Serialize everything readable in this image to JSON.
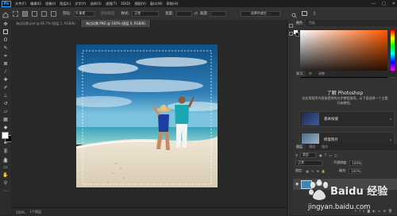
{
  "menubar": {
    "logo": "Ps",
    "items": [
      "文件(F)",
      "编辑(E)",
      "图像(I)",
      "图层(L)",
      "文字(Y)",
      "选择(S)",
      "滤镜(T)",
      "3D(D)",
      "视图(V)",
      "窗口(W)",
      "帮助(H)"
    ],
    "win_min": "—",
    "win_max": "□",
    "win_close": "✕"
  },
  "options": {
    "feather_label": "羽化:",
    "feather_value": "0 像素",
    "antialias_label": "消除锯齿",
    "style_label": "样式:",
    "style_value": "正常",
    "width_label": "宽度:",
    "height_label": "高度:",
    "select_mask": "选择并遮住 ..."
  },
  "documents": {
    "tab1": "海边风景.psd @ 66.7% (图层 1, RGB/8)",
    "tab2": "海边风景.PNG @ 100% (图层 0, RGB/8)"
  },
  "status": {
    "zoom": "100%",
    "info": "1个图层"
  },
  "panels": {
    "color_tabs": [
      "颜色",
      "色板"
    ],
    "learn_tabs": [
      "学习",
      "库",
      "调整"
    ],
    "learn_title": "了解 Photoshop",
    "learn_desc": "在应用程序内直接提供的分步教程指导。从下面选择一个主题开始教程。",
    "card1": "基本技能",
    "card2": "修复照片",
    "layer_tabs": [
      "图层",
      "通道",
      "路径"
    ],
    "kind_label": "类型",
    "blend_mode": "正常",
    "opacity_label": "不透明度:",
    "opacity_value": "100%",
    "lock_label": "锁定:",
    "fill_label": "填充:",
    "fill_value": "100%",
    "layer_name": "图层 0"
  },
  "watermark": {
    "brand": "Baidu 经验",
    "url": "jingyan.baidu.com"
  }
}
